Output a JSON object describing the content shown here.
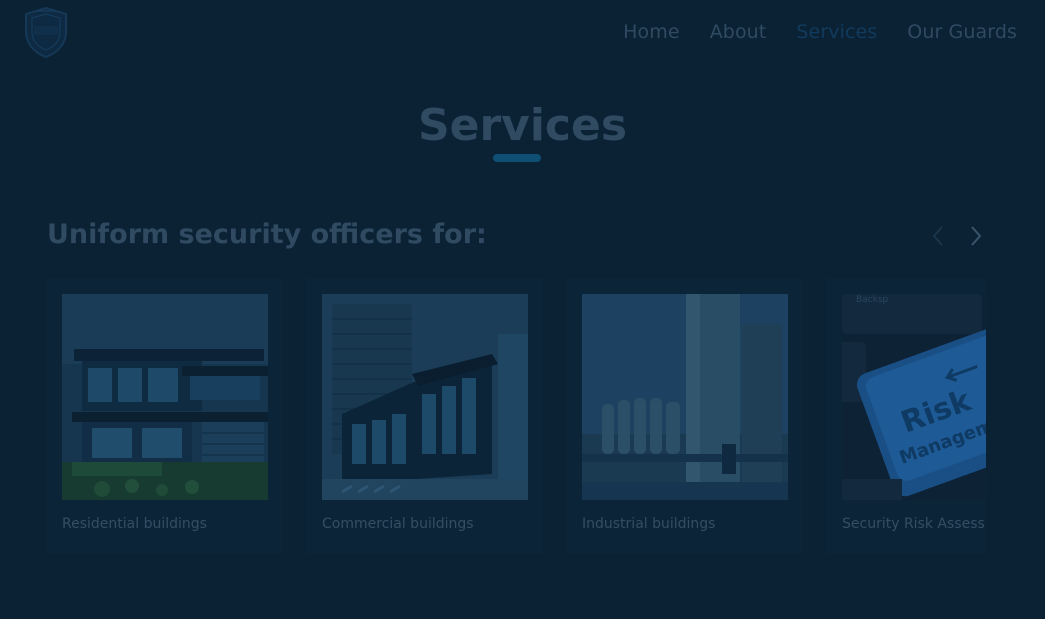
{
  "header": {
    "logo_icon": "shield-logo-icon",
    "nav": [
      {
        "label": "Home"
      },
      {
        "label": "About"
      },
      {
        "label": "Services",
        "active": true
      },
      {
        "label": "Our Guards"
      }
    ]
  },
  "main": {
    "title": "Services",
    "subtitle": "Uniform security officers for:",
    "carousel": {
      "prev_icon": "chevron-left-icon",
      "next_icon": "chevron-right-icon",
      "cards": [
        {
          "label": "Residential buildings",
          "image": "residential-house-photo"
        },
        {
          "label": "Commercial buildings",
          "image": "commercial-building-photo"
        },
        {
          "label": "Industrial buildings",
          "image": "industrial-silos-photo"
        },
        {
          "label": "Security Risk Assessr",
          "image": "risk-management-key-photo"
        }
      ]
    }
  },
  "colors": {
    "background": "#0b2235",
    "text_muted": "#2f4a61",
    "accent": "#0f4f73",
    "nav_active": "#113a5c"
  }
}
